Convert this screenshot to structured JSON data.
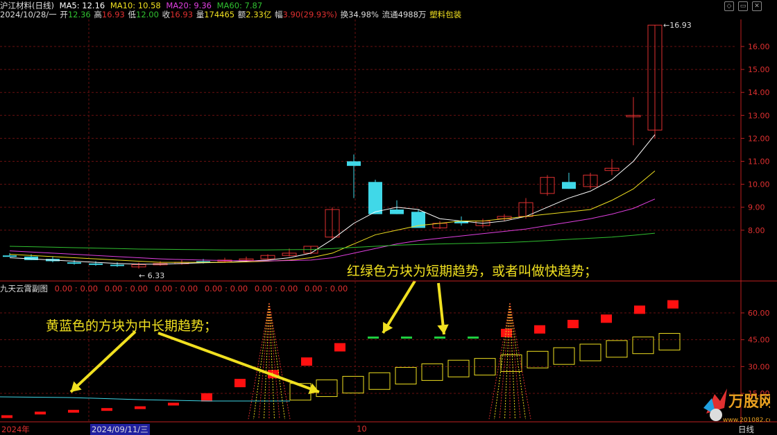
{
  "header": {
    "stock_name": "沪江材料(日线)",
    "ma5": "MA5: 12.16",
    "ma10": "MA10: 10.58",
    "ma20": "MA20: 9.36",
    "ma60": "MA60: 7.87",
    "date": "2024/10/28/一",
    "open_label": "开",
    "open": "12.36",
    "high_label": "高",
    "high": "16.93",
    "low_label": "低",
    "low": "12.00",
    "close_label": "收",
    "close": "16.93",
    "vol_label": "量",
    "vol": "174465",
    "amt_label": "额",
    "amt": "2.33亿",
    "chg_label": "幅",
    "chg": "3.90(29.93%)",
    "turnover": "换34.98%",
    "float": "流通4988万",
    "sector": "塑料包装",
    "colors": {
      "ma5": "#ffffff",
      "ma10": "#f0e020",
      "ma20": "#e040e0",
      "ma60": "#30c030",
      "up": "#e03030",
      "down": "#40d8e8"
    }
  },
  "main_chart": {
    "y_ticks": [
      "16.00",
      "15.00",
      "14.00",
      "13.00",
      "12.00",
      "11.00",
      "10.00",
      "9.00",
      "8.00"
    ],
    "max_label": "16.93",
    "min_label": "6.33"
  },
  "sub_chart": {
    "title": "九天云霄副图",
    "zeros": [
      "0.00 : 0.00",
      "0.00 : 0.00",
      "0.00 : 0.00",
      "0.00 : 0.00",
      "0.00 : 0.00",
      "0.00 : 0.00"
    ],
    "y_ticks": [
      "60.00",
      "45.00",
      "30.00",
      "15.00"
    ]
  },
  "annotations": {
    "short_term": "红绿色方块为短期趋势，或者叫做快趋势；",
    "long_term": "黄蓝色的方块为中长期趋势；"
  },
  "bottom": {
    "year": "2024年",
    "date": "2024/09/11/三",
    "month": "10",
    "period": "日线"
  },
  "logo": {
    "name": "万股网",
    "url": "www.201082.com"
  },
  "chart_data": {
    "type": "candlestick",
    "candles_up": [
      [
        6.4,
        6.6,
        6.3,
        6.5
      ],
      [
        6.5,
        6.7,
        6.45,
        6.6
      ],
      [
        6.6,
        6.8,
        6.5,
        6.7
      ],
      [
        7.2,
        7.4,
        7.0,
        7.3
      ],
      [
        7.7,
        9.0,
        7.5,
        8.9
      ],
      [
        8.2,
        8.5,
        8.1,
        8.3
      ],
      [
        8.1,
        8.4,
        8.05,
        8.2
      ],
      [
        8.4,
        8.6,
        8.3,
        8.5
      ],
      [
        8.5,
        9.1,
        8.4,
        8.9
      ],
      [
        9.8,
        10.4,
        9.6,
        10.4
      ],
      [
        10.0,
        10.7,
        9.8,
        10.4
      ],
      [
        10.6,
        11.0,
        10.4,
        10.7
      ],
      [
        13.0,
        13.8,
        11.7,
        13.0
      ],
      [
        12.36,
        16.93,
        12.0,
        16.93
      ]
    ],
    "candles_down": [
      [
        7.3,
        7.4,
        7.0,
        7.1
      ],
      [
        6.8,
        6.9,
        6.6,
        6.7
      ],
      [
        11.0,
        11.3,
        9.4,
        10.8
      ],
      [
        10.1,
        10.2,
        8.7,
        8.7
      ],
      [
        8.9,
        9.3,
        8.7,
        8.7
      ],
      [
        8.8,
        8.9,
        8.1,
        8.1
      ],
      [
        8.4,
        8.6,
        8.2,
        8.3
      ],
      [
        10.0,
        10.5,
        9.8,
        9.7
      ]
    ],
    "sub_red_blocks": [
      2,
      4,
      5,
      6,
      7,
      9,
      12,
      20,
      25,
      32,
      40,
      46,
      46,
      46,
      46,
      48,
      50,
      53,
      56,
      61,
      64
    ],
    "sub_yellow_blocks": [
      12,
      14,
      16,
      18,
      21,
      23,
      25,
      26,
      28,
      30,
      32,
      34,
      36,
      38,
      40
    ]
  }
}
